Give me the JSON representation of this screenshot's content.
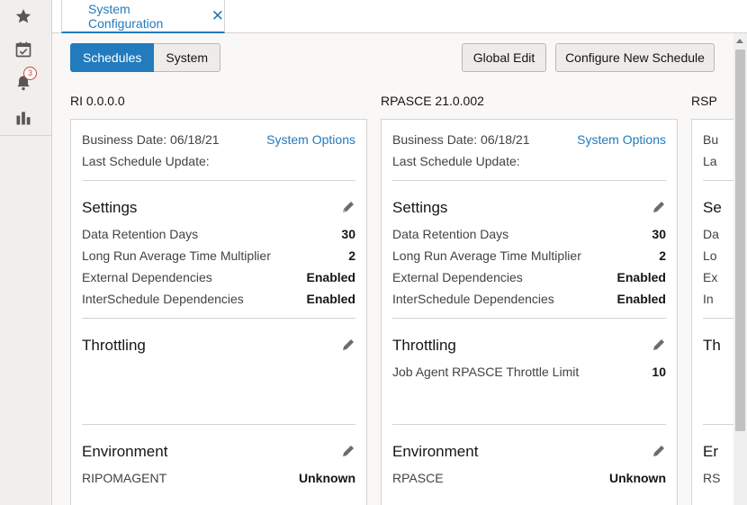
{
  "rail": {
    "items": [
      {
        "icon": "star-icon"
      },
      {
        "icon": "calendar-check-icon"
      },
      {
        "icon": "bell-icon",
        "badge": "3"
      },
      {
        "icon": "bar-chart-icon"
      }
    ]
  },
  "tab": {
    "label": "System Configuration",
    "close": "✕"
  },
  "toggle": {
    "schedules": "Schedules",
    "system": "System"
  },
  "actions": {
    "global_edit": "Global Edit",
    "configure_new": "Configure New Schedule"
  },
  "columns": [
    {
      "title": "RI 0.0.0.0",
      "business_date": "Business Date: 06/18/21",
      "system_options": "System Options",
      "last_update": "Last Schedule Update:",
      "settings_title": "Settings",
      "settings": [
        {
          "label": "Data Retention Days",
          "value": "30"
        },
        {
          "label": "Long Run Average Time Multiplier",
          "value": "2"
        },
        {
          "label": "External Dependencies",
          "value": "Enabled"
        },
        {
          "label": "InterSchedule Dependencies",
          "value": "Enabled"
        }
      ],
      "throttling_title": "Throttling",
      "throttling": [],
      "environment_title": "Environment",
      "environment": [
        {
          "label": "RIPOMAGENT",
          "value": "Unknown"
        }
      ]
    },
    {
      "title": "RPASCE 21.0.002",
      "business_date": "Business Date: 06/18/21",
      "system_options": "System Options",
      "last_update": "Last Schedule Update:",
      "settings_title": "Settings",
      "settings": [
        {
          "label": "Data Retention Days",
          "value": "30"
        },
        {
          "label": "Long Run Average Time Multiplier",
          "value": "2"
        },
        {
          "label": "External Dependencies",
          "value": "Enabled"
        },
        {
          "label": "InterSchedule Dependencies",
          "value": "Enabled"
        }
      ],
      "throttling_title": "Throttling",
      "throttling": [
        {
          "label": "Job Agent RPASCE Throttle Limit",
          "value": "10"
        }
      ],
      "environment_title": "Environment",
      "environment": [
        {
          "label": "RPASCE",
          "value": "Unknown"
        }
      ]
    },
    {
      "title": "RSP",
      "business_date": "Bu",
      "last_update": "La",
      "settings_title": "Se",
      "settings": [
        {
          "label": "Da"
        },
        {
          "label": "Lo"
        },
        {
          "label": "Ex"
        },
        {
          "label": "In"
        }
      ],
      "throttling_title": "Th",
      "environment_title": "Er",
      "environment": [
        {
          "label": "RS"
        }
      ]
    }
  ],
  "colors": {
    "accent": "#227bbd",
    "badge": "#c74634",
    "icon": "#5b5652"
  }
}
